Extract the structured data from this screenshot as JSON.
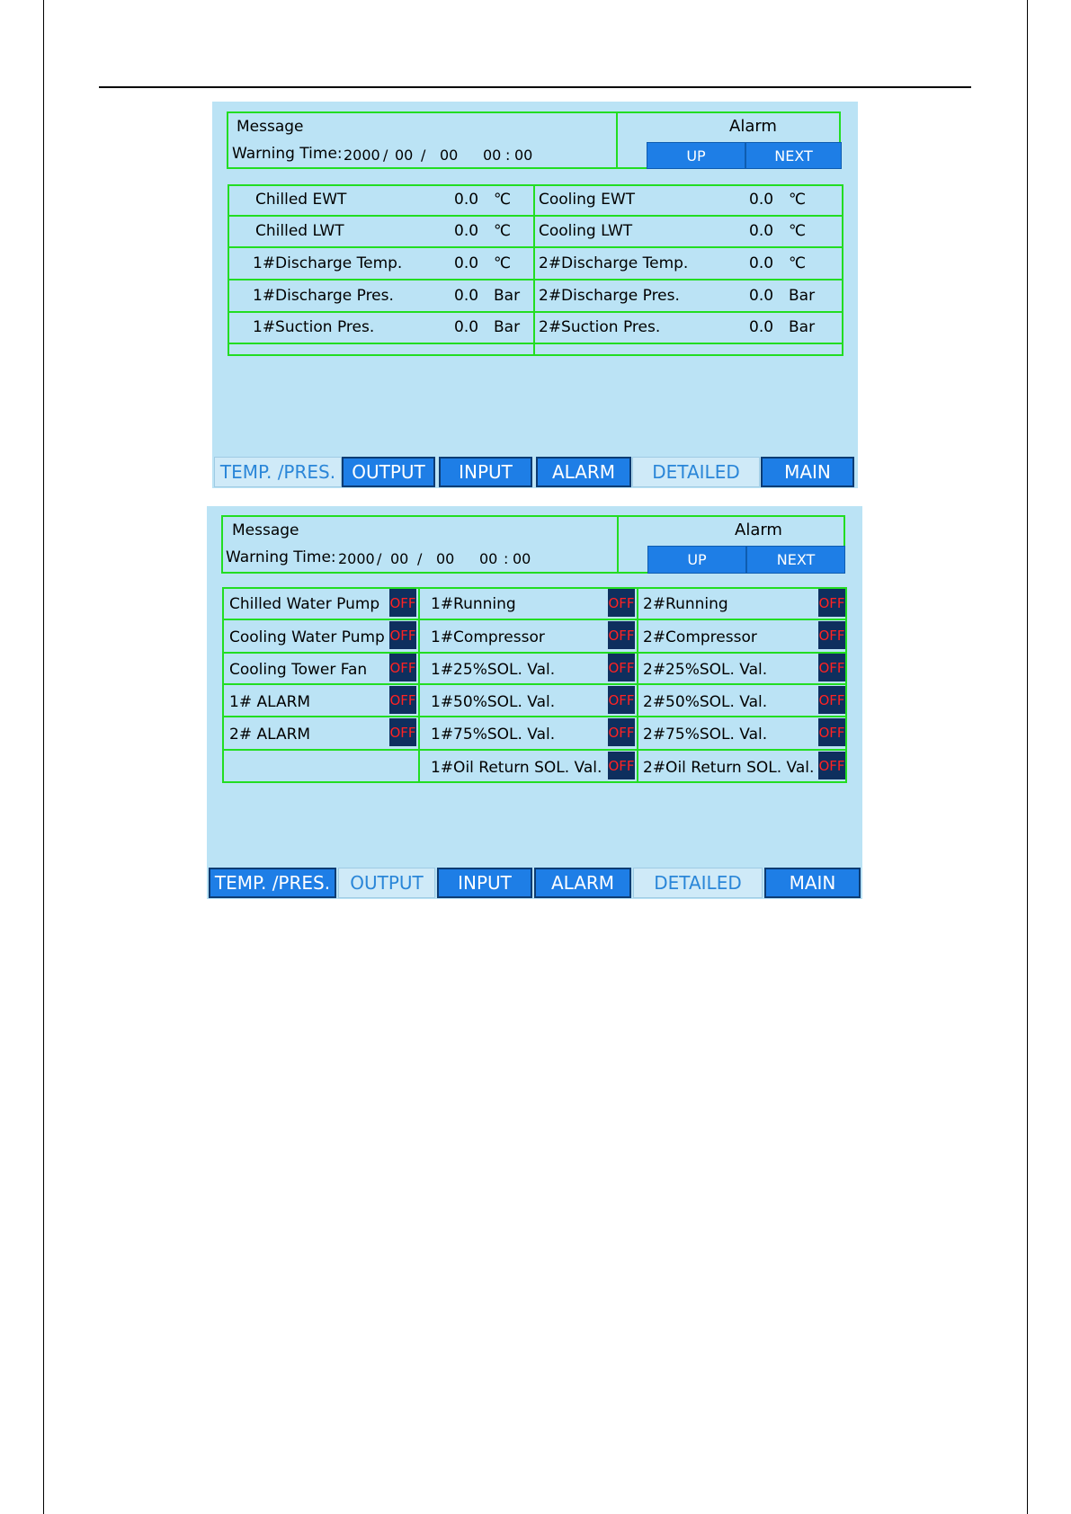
{
  "panel1": {
    "message_label": "Message",
    "warning_time_label": "Warning Time:",
    "time": {
      "year": "2000",
      "sep1": "/",
      "month": "00",
      "sep2": "/",
      "day": "00",
      "hour": "00",
      "sep3": ":",
      "minute": "00"
    },
    "alarm_label": "Alarm",
    "up_label": "UP",
    "next_label": "NEXT",
    "rows": [
      {
        "left_name": "Chilled EWT",
        "left_value": "0.0",
        "left_unit": "℃",
        "right_name": "Cooling EWT",
        "right_value": "0.0",
        "right_unit": "℃"
      },
      {
        "left_name": "Chilled LWT",
        "left_value": "0.0",
        "left_unit": "℃",
        "right_name": "Cooling LWT",
        "right_value": "0.0",
        "right_unit": "℃"
      },
      {
        "left_name": "1#Discharge Temp.",
        "left_value": "0.0",
        "left_unit": "℃",
        "right_name": "2#Discharge Temp.",
        "right_value": "0.0",
        "right_unit": "℃"
      },
      {
        "left_name": "1#Discharge Pres.",
        "left_value": "0.0",
        "left_unit": "Bar",
        "right_name": "2#Discharge Pres.",
        "right_value": "0.0",
        "right_unit": "Bar"
      },
      {
        "left_name": "1#Suction Pres.",
        "left_value": "0.0",
        "left_unit": "Bar",
        "right_name": "2#Suction Pres.",
        "right_value": "0.0",
        "right_unit": "Bar"
      }
    ],
    "tabs": [
      "TEMP. /PRES.",
      "OUTPUT",
      "INPUT",
      "ALARM",
      "DETAILED",
      "MAIN"
    ]
  },
  "panel2": {
    "message_label": "Message",
    "warning_time_label": "Warning Time:",
    "time": {
      "year": "2000",
      "sep1": "/",
      "month": "00",
      "sep2": "/",
      "day": "00",
      "hour": "00",
      "sep3": ":",
      "minute": "00"
    },
    "alarm_label": "Alarm",
    "up_label": "UP",
    "next_label": "NEXT",
    "col1": [
      "Chilled Water Pump",
      "Cooling Water Pump",
      "Cooling Tower Fan",
      "1# ALARM",
      "2# ALARM"
    ],
    "col2": [
      "1#Running",
      "1#Compressor",
      "1#25%SOL. Val.",
      "1#50%SOL. Val.",
      "1#75%SOL. Val.",
      "1#Oil Return SOL. Val."
    ],
    "col3": [
      "2#Running",
      "2#Compressor",
      "2#25%SOL. Val.",
      "2#50%SOL. Val.",
      "2#75%SOL. Val.",
      "2#Oil Return SOL. Val."
    ],
    "status": "OFF",
    "tabs": [
      "TEMP. /PRES.",
      "OUTPUT",
      "INPUT",
      "ALARM",
      "DETAILED",
      "MAIN"
    ]
  }
}
